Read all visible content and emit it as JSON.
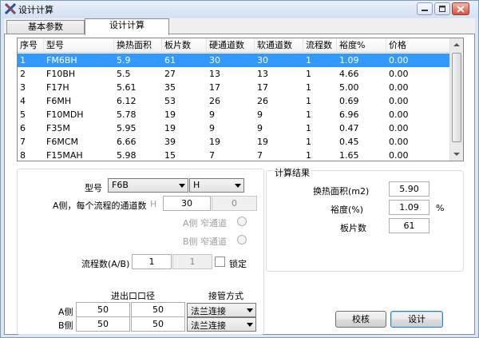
{
  "window": {
    "title": "设计计算"
  },
  "tabs": [
    {
      "label": "基本参数"
    },
    {
      "label": "设计计算"
    }
  ],
  "table": {
    "columns": [
      "序号",
      "型号",
      "换热面积",
      "板片数",
      "硬通道数",
      "软通道数",
      "流程数",
      "裕度%",
      "价格"
    ],
    "rows": [
      [
        "1",
        "FM6BH",
        "5.9",
        "61",
        "30",
        "30",
        "1",
        "1.09",
        "0.00"
      ],
      [
        "2",
        "F10BH",
        "5.5",
        "27",
        "13",
        "13",
        "1",
        "4.66",
        "0.00"
      ],
      [
        "3",
        "F17H",
        "5.61",
        "35",
        "17",
        "17",
        "1",
        "5.00",
        "0.00"
      ],
      [
        "4",
        "F6MH",
        "6.12",
        "53",
        "26",
        "26",
        "1",
        "0.69",
        "0.00"
      ],
      [
        "5",
        "F10MDH",
        "5.78",
        "19",
        "9",
        "9",
        "1",
        "6.96",
        "0.00"
      ],
      [
        "6",
        "F35M",
        "5.95",
        "19",
        "9",
        "9",
        "1",
        "0.47",
        "0.00"
      ],
      [
        "7",
        "F6MCM",
        "6.66",
        "39",
        "19",
        "19",
        "1",
        "0.45",
        "0.00"
      ],
      [
        "8",
        "F15MAH",
        "5.98",
        "15",
        "7",
        "7",
        "1",
        "1.65",
        "0.00"
      ]
    ],
    "selected_row": 1
  },
  "params": {
    "model_label": "型号",
    "model_value": "F6B",
    "model_suffix": "H",
    "channels_label": "A侧，每个流程的通道数",
    "h_label": "H",
    "channels_value": "30",
    "channels_value2": "0",
    "a_side_label": "A侧 窄通道",
    "b_side_label": "B侧 窄通道",
    "passes_label": "流程数(A/B)",
    "passes_a": "1",
    "passes_b": "1",
    "lock_label": "锁定",
    "port_label": "进出口口径",
    "pipe_label": "接管方式",
    "a_label": "A侧",
    "b_label": "B侧",
    "a_in": "50",
    "a_out": "50",
    "b_in": "50",
    "b_out": "50",
    "a_conn": "法兰连接",
    "b_conn": "法兰连接"
  },
  "results": {
    "title": "计算结果",
    "area_label": "换热面积(m2)",
    "area_value": "5.90",
    "margin_label": "裕度(%)",
    "margin_value": "1.09",
    "margin_unit": "%",
    "plates_label": "板片数",
    "plates_value": "61"
  },
  "buttons": {
    "check": "校核",
    "design": "设计"
  },
  "colors": {
    "selection": "#3399ff"
  }
}
